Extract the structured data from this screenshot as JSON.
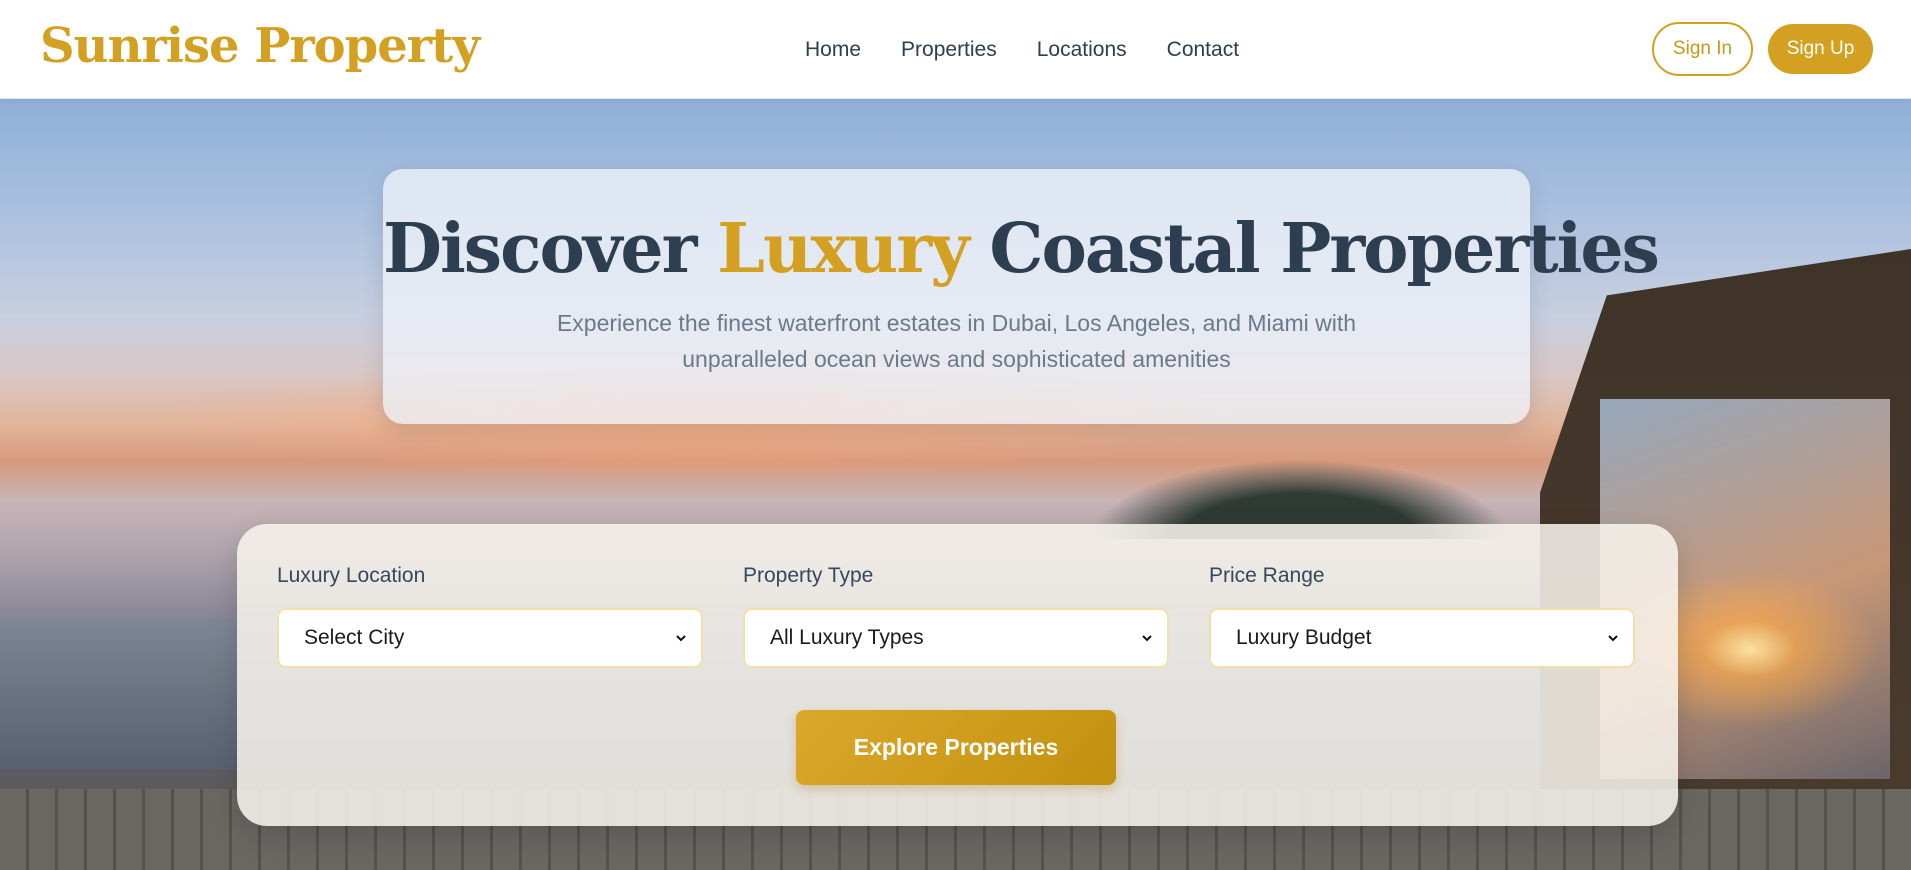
{
  "brand": {
    "name": "Sunrise Property",
    "accent_color": "#d4a022"
  },
  "nav": {
    "links": [
      {
        "label": "Home"
      },
      {
        "label": "Properties"
      },
      {
        "label": "Locations"
      },
      {
        "label": "Contact"
      }
    ],
    "sign_in": "Sign In",
    "sign_up": "Sign Up"
  },
  "hero": {
    "title_before": "Discover",
    "title_accent": "Luxury",
    "title_after": "Coastal Properties",
    "subtitle": "Experience the finest waterfront estates in Dubai, Los Angeles, and Miami with unparalleled ocean views and sophisticated amenities"
  },
  "search": {
    "fields": [
      {
        "label": "Luxury Location",
        "selected": "Select City"
      },
      {
        "label": "Property Type",
        "selected": "All Luxury Types"
      },
      {
        "label": "Price Range",
        "selected": "Luxury Budget"
      }
    ],
    "submit_label": "Explore Properties"
  },
  "colors": {
    "text_dark": "#2c3e50",
    "text_muted": "#6b7a89",
    "gold": "#d4a022"
  }
}
